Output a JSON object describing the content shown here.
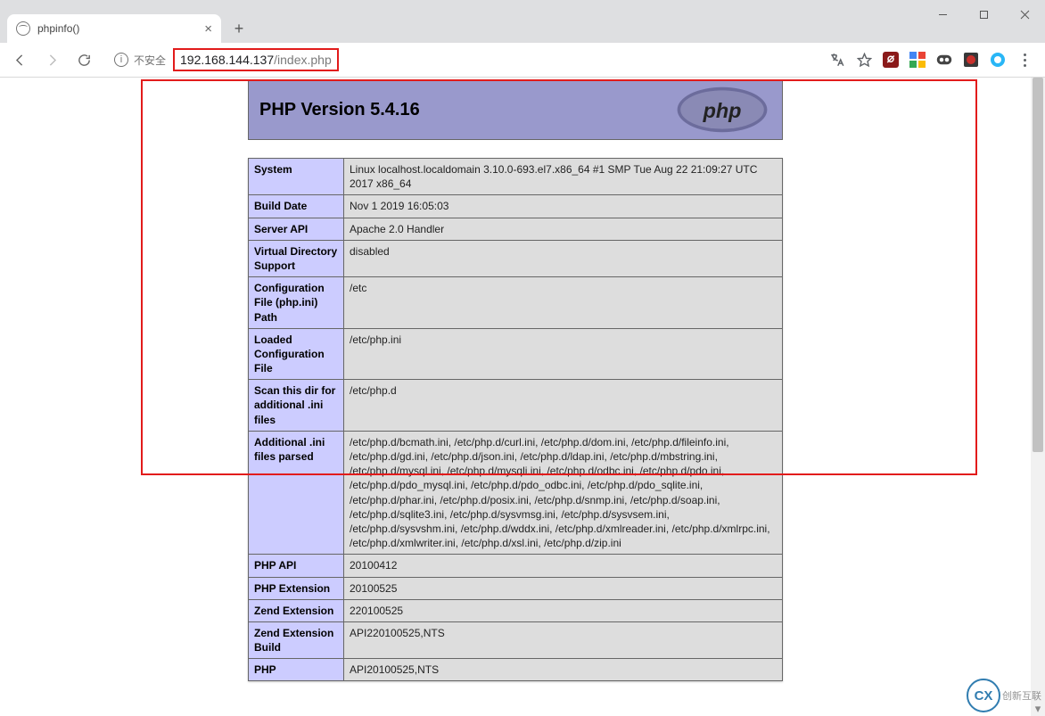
{
  "window": {
    "minimize": "—",
    "maximize": "□",
    "close": "×"
  },
  "tab": {
    "title": "phpinfo()",
    "close": "×",
    "newtab": "+"
  },
  "addr": {
    "security_label": "不安全",
    "url_host": "192.168.144.137",
    "url_path": "/index.php"
  },
  "phpinfo": {
    "header": "PHP Version 5.4.16",
    "rows": [
      {
        "k": "System",
        "v": "Linux localhost.localdomain 3.10.0-693.el7.x86_64 #1 SMP Tue Aug 22 21:09:27 UTC 2017 x86_64"
      },
      {
        "k": "Build Date",
        "v": "Nov 1 2019 16:05:03"
      },
      {
        "k": "Server API",
        "v": "Apache 2.0 Handler"
      },
      {
        "k": "Virtual Directory Support",
        "v": "disabled"
      },
      {
        "k": "Configuration File (php.ini) Path",
        "v": "/etc"
      },
      {
        "k": "Loaded Configuration File",
        "v": "/etc/php.ini"
      },
      {
        "k": "Scan this dir for additional .ini files",
        "v": "/etc/php.d"
      },
      {
        "k": "Additional .ini files parsed",
        "v": "/etc/php.d/bcmath.ini, /etc/php.d/curl.ini, /etc/php.d/dom.ini, /etc/php.d/fileinfo.ini, /etc/php.d/gd.ini, /etc/php.d/json.ini, /etc/php.d/ldap.ini, /etc/php.d/mbstring.ini, /etc/php.d/mysql.ini, /etc/php.d/mysqli.ini, /etc/php.d/odbc.ini, /etc/php.d/pdo.ini, /etc/php.d/pdo_mysql.ini, /etc/php.d/pdo_odbc.ini, /etc/php.d/pdo_sqlite.ini, /etc/php.d/phar.ini, /etc/php.d/posix.ini, /etc/php.d/snmp.ini, /etc/php.d/soap.ini, /etc/php.d/sqlite3.ini, /etc/php.d/sysvmsg.ini, /etc/php.d/sysvsem.ini, /etc/php.d/sysvshm.ini, /etc/php.d/wddx.ini, /etc/php.d/xmlreader.ini, /etc/php.d/xmlrpc.ini, /etc/php.d/xmlwriter.ini, /etc/php.d/xsl.ini, /etc/php.d/zip.ini"
      },
      {
        "k": "PHP API",
        "v": "20100412"
      },
      {
        "k": "PHP Extension",
        "v": "20100525"
      },
      {
        "k": "Zend Extension",
        "v": "220100525"
      },
      {
        "k": "Zend Extension Build",
        "v": "API220100525,NTS"
      },
      {
        "k": "PHP",
        "v": "API20100525,NTS"
      }
    ]
  },
  "watermark": {
    "text": "创新互联"
  }
}
